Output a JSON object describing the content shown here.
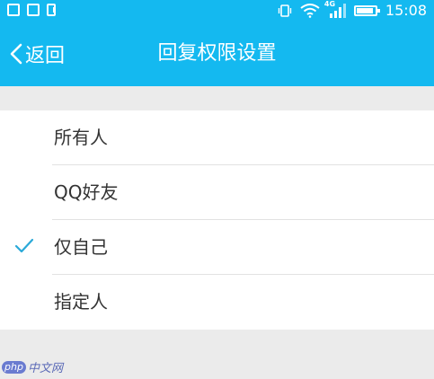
{
  "status_bar": {
    "time": "15:08",
    "network_label": "4G",
    "battery_level": 0.9,
    "icons": [
      "image-icon",
      "gallery-icon",
      "alert-icon",
      "vibrate-icon",
      "wifi-icon",
      "signal-icon",
      "battery-icon"
    ]
  },
  "header": {
    "back_label": "返回",
    "title": "回复权限设置"
  },
  "options": [
    {
      "label": "所有人",
      "selected": false
    },
    {
      "label": "QQ好友",
      "selected": false
    },
    {
      "label": "仅自己",
      "selected": true
    },
    {
      "label": "指定人",
      "selected": false
    }
  ],
  "watermark": {
    "php": "php",
    "text": "中文网"
  },
  "colors": {
    "accent": "#14b9f0",
    "check": "#2aa9d8",
    "background": "#ebebeb",
    "list_background": "#ffffff"
  }
}
